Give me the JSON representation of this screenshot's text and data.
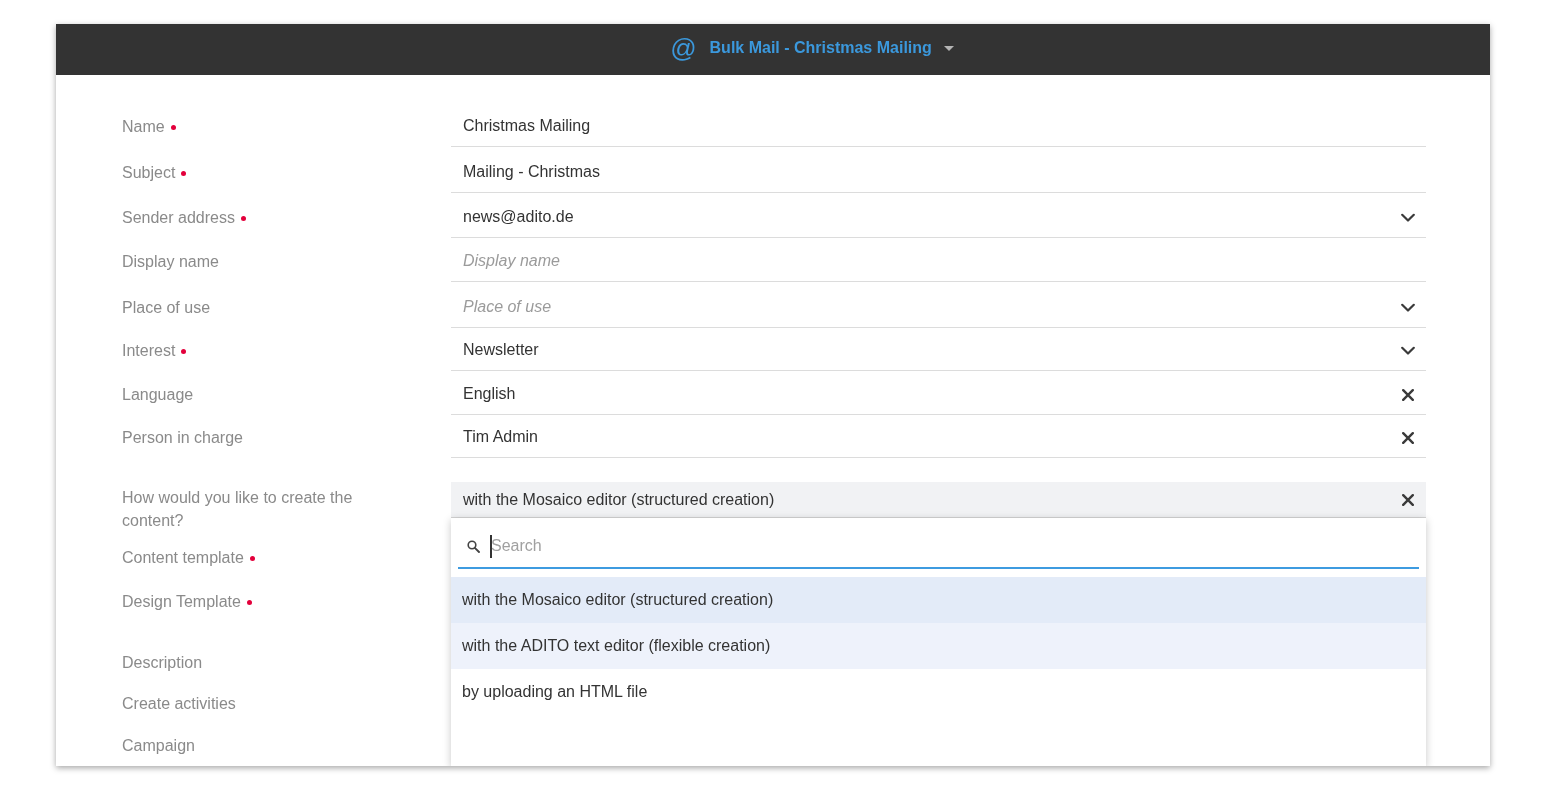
{
  "header": {
    "icon": "@",
    "title": "Bulk Mail - Christmas Mailing"
  },
  "rows": [
    {
      "label": "Name",
      "required": true,
      "input": {
        "kind": "text",
        "value": "Christmas Mailing",
        "open": false
      }
    },
    {
      "label": "Subject",
      "required": true,
      "input": {
        "kind": "text",
        "value": "Mailing - Christmas",
        "open": false
      }
    },
    {
      "label": "Sender address",
      "required": true,
      "input": {
        "kind": "select",
        "value": "news@adito.de",
        "open": false
      }
    },
    {
      "label": "Display name",
      "required": false,
      "input": {
        "kind": "text",
        "placeholder": "Display name",
        "open": false
      }
    },
    {
      "label": "Place of use",
      "required": false,
      "input": {
        "kind": "select",
        "placeholder": "Place of use",
        "open": false
      }
    },
    {
      "label": "Interest",
      "required": true,
      "input": {
        "kind": "select",
        "value": "Newsletter",
        "open": false
      }
    },
    {
      "label": "Language",
      "required": false,
      "input": {
        "kind": "clearable",
        "value": "English",
        "open": false
      }
    },
    {
      "label": "Person in charge",
      "required": false,
      "input": {
        "kind": "clearable",
        "value": "Tim Admin",
        "open": false
      }
    },
    {
      "label": "How would you like to create the content?",
      "required": false,
      "input": {
        "kind": "clearable",
        "value": "with the Mosaico editor (structured creation)",
        "open": true,
        "dropdown": {
          "search": {
            "placeholder": "Search",
            "focused": true
          },
          "options": [
            {
              "label": "with the Mosaico editor (structured creation)",
              "selected": true,
              "highlighted": false
            },
            {
              "label": "with the ADITO text editor (flexible creation)",
              "selected": false,
              "highlighted": true
            },
            {
              "label": "by uploading an HTML file",
              "selected": false,
              "highlighted": false
            }
          ]
        }
      }
    },
    {
      "label": "Content template",
      "required": true
    },
    {
      "label": "Design Template",
      "required": true
    },
    {
      "label": "Description",
      "required": false
    },
    {
      "label": "Create activities",
      "required": false
    },
    {
      "label": "Campaign",
      "required": false
    }
  ]
}
